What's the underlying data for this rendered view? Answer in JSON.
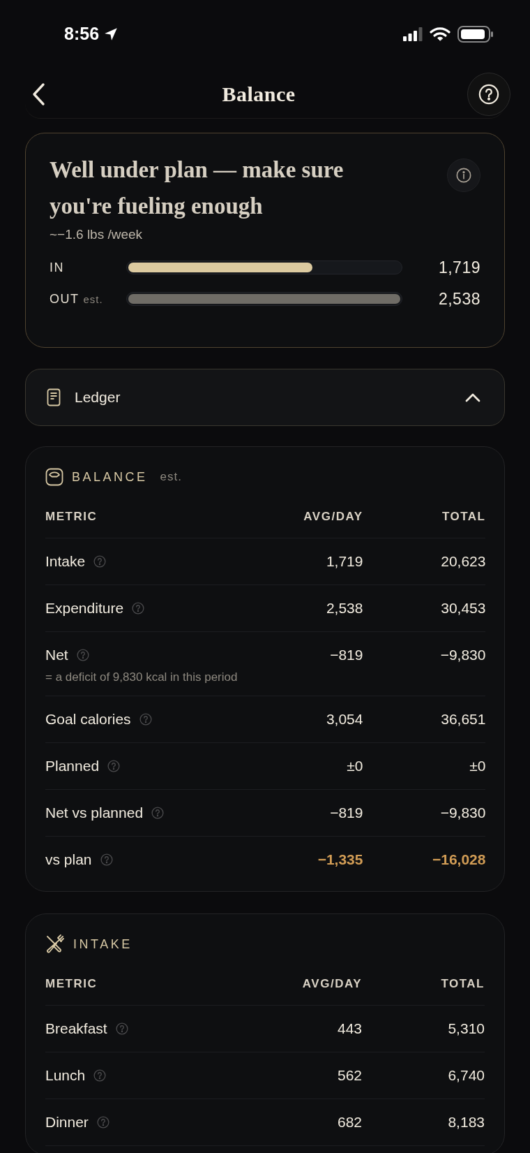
{
  "status_bar": {
    "time": "8:56"
  },
  "header": {
    "title": "Balance"
  },
  "summary": {
    "headline": "Well under plan — make sure you're fueling enough",
    "rate": "~−1.6 lbs /week",
    "bars": [
      {
        "label": "IN",
        "level": 0.677,
        "value": "1,719",
        "kind": "intake"
      },
      {
        "label": "OUT",
        "note": "est.",
        "level": 1,
        "value": "2,538",
        "kind": "output"
      }
    ]
  },
  "ledger": {
    "label": "Ledger",
    "expanded": true
  },
  "sections": [
    {
      "kind": "balance",
      "title": "BALANCE",
      "note": "est.",
      "columns": [
        "METRIC",
        "AVG/DAY",
        "TOTAL"
      ],
      "rows": [
        {
          "metric": "Intake",
          "avg": "1,719",
          "total": "20,623",
          "highlighted": false
        },
        {
          "metric": "Expenditure",
          "avg": "2,538",
          "total": "30,453",
          "highlighted": false
        },
        {
          "metric": "Net",
          "avg": "−819",
          "total": "−9,830",
          "highlighted": false,
          "detail": "= a deficit of 9,830 kcal in this period"
        },
        {
          "metric": "Goal calories",
          "avg": "3,054",
          "total": "36,651",
          "highlighted": false
        },
        {
          "metric": "Planned",
          "avg": "±0",
          "total": "±0",
          "highlighted": false
        },
        {
          "metric": "Net vs planned",
          "avg": "−819",
          "total": "−9,830",
          "highlighted": false
        },
        {
          "metric": "vs plan",
          "avg": "−1,335",
          "total": "−16,028",
          "highlighted": true
        }
      ]
    },
    {
      "kind": "intake",
      "title": "INTAKE",
      "columns": [
        "METRIC",
        "AVG/DAY",
        "TOTAL"
      ],
      "rows": [
        {
          "metric": "Breakfast",
          "avg": "443",
          "total": "5,310",
          "highlighted": false
        },
        {
          "metric": "Lunch",
          "avg": "562",
          "total": "6,740",
          "highlighted": false
        },
        {
          "metric": "Dinner",
          "avg": "682",
          "total": "8,183",
          "highlighted": false
        }
      ]
    }
  ]
}
